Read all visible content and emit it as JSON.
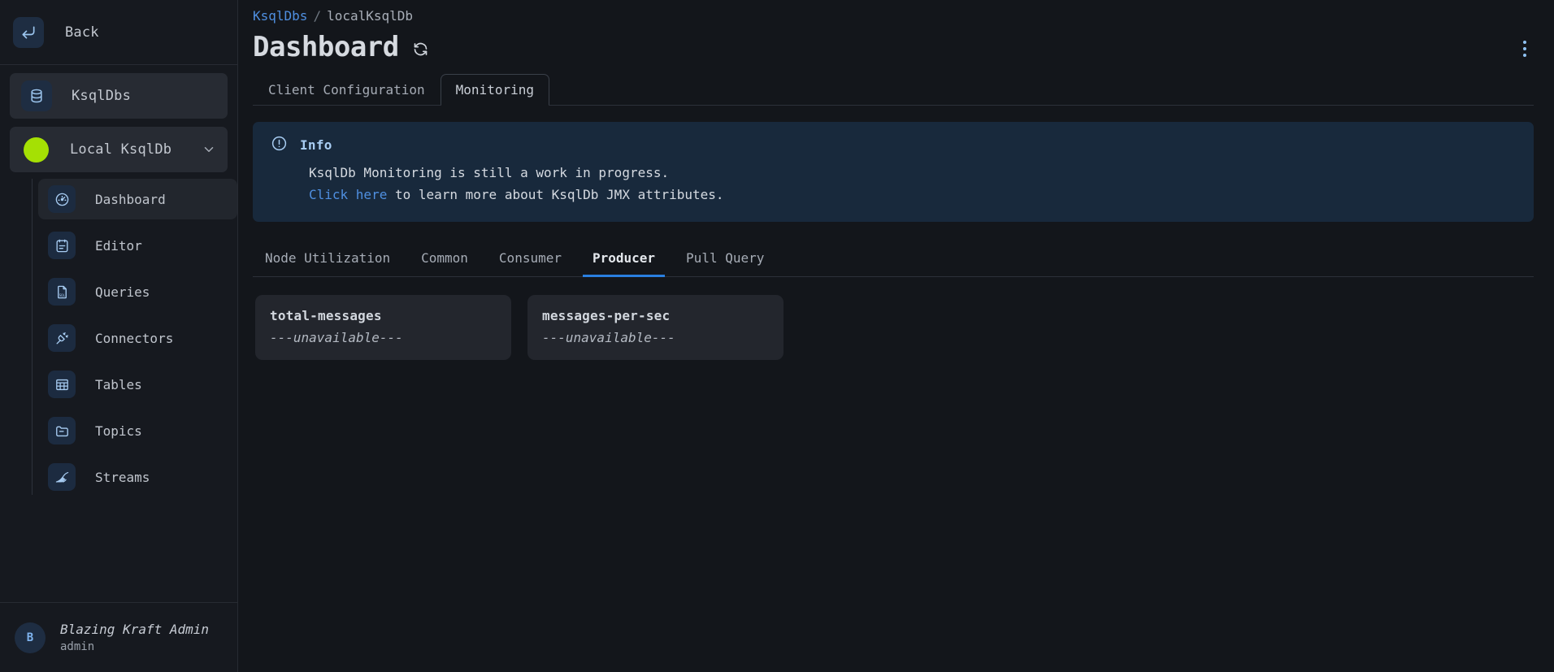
{
  "sidebar": {
    "back_label": "Back",
    "back_icon": "enter-arrow-icon",
    "ksqldbs_label": "KsqlDbs",
    "ksqldbs_icon": "database-icon",
    "cluster": {
      "label": "Local KsqlDb",
      "status_color": "#a5e004",
      "chevron_icon": "chevron-down-icon"
    },
    "nav_items": [
      {
        "label": "Dashboard",
        "icon": "gauge-icon",
        "active": true
      },
      {
        "label": "Editor",
        "icon": "clipboard-icon",
        "active": false
      },
      {
        "label": "Queries",
        "icon": "sql-file-icon",
        "active": false
      },
      {
        "label": "Connectors",
        "icon": "plug-icon",
        "active": false
      },
      {
        "label": "Tables",
        "icon": "table-icon",
        "active": false
      },
      {
        "label": "Topics",
        "icon": "folder-icon",
        "active": false
      },
      {
        "label": "Streams",
        "icon": "stream-icon",
        "active": false
      }
    ],
    "user": {
      "avatar_initial": "B",
      "name": "Blazing Kraft Admin",
      "role": "admin"
    }
  },
  "header": {
    "breadcrumb_root": "KsqlDbs",
    "breadcrumb_sep": "/",
    "breadcrumb_current": "localKsqlDb",
    "title": "Dashboard",
    "refresh_icon": "refresh-icon",
    "menu_icon": "kebab-menu-icon"
  },
  "tabs": [
    {
      "label": "Client Configuration",
      "active": false
    },
    {
      "label": "Monitoring",
      "active": true
    }
  ],
  "info_banner": {
    "icon": "exclamation-circle-icon",
    "title": "Info",
    "line1": "KsqlDb Monitoring is still a work in progress.",
    "link_text": "Click here",
    "line2_rest": " to learn more about KsqlDb JMX attributes.",
    "accent_color": "#4f8fe0"
  },
  "subtabs": [
    {
      "label": "Node Utilization",
      "active": false
    },
    {
      "label": "Common",
      "active": false
    },
    {
      "label": "Consumer",
      "active": false
    },
    {
      "label": "Producer",
      "active": true
    },
    {
      "label": "Pull Query",
      "active": false
    }
  ],
  "metric_cards": [
    {
      "title": "total-messages",
      "value": "---unavailable---"
    },
    {
      "title": "messages-per-sec",
      "value": "---unavailable---"
    }
  ]
}
